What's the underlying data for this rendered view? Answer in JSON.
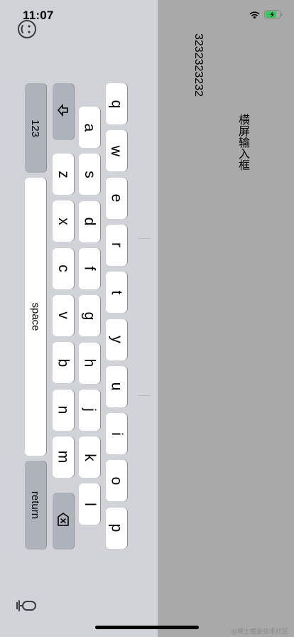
{
  "status": {
    "time": "11:07",
    "wifi_icon": "wifi-icon",
    "battery_icon": "battery-charging-icon",
    "battery_color": "#34c759"
  },
  "content": {
    "input_value": "3232323232",
    "input_label": "横屏输入框",
    "background_color": "#a9a9a9"
  },
  "keyboard": {
    "row_top": [
      "q",
      "w",
      "e",
      "r",
      "t",
      "y",
      "u",
      "i",
      "o",
      "p"
    ],
    "row_middle": [
      "a",
      "s",
      "d",
      "f",
      "g",
      "h",
      "j",
      "k",
      "l"
    ],
    "row_bottom": [
      "z",
      "x",
      "c",
      "v",
      "b",
      "n",
      "m"
    ],
    "numbers_label": "123",
    "space_label": "space",
    "return_label": "return",
    "shift_icon": "shift-arrow-icon",
    "delete_icon": "delete-backspace-icon",
    "emoji_icon": "emoji-icon",
    "dictation_icon": "microphone-icon"
  },
  "watermark": "@稀土掘金技术社区"
}
